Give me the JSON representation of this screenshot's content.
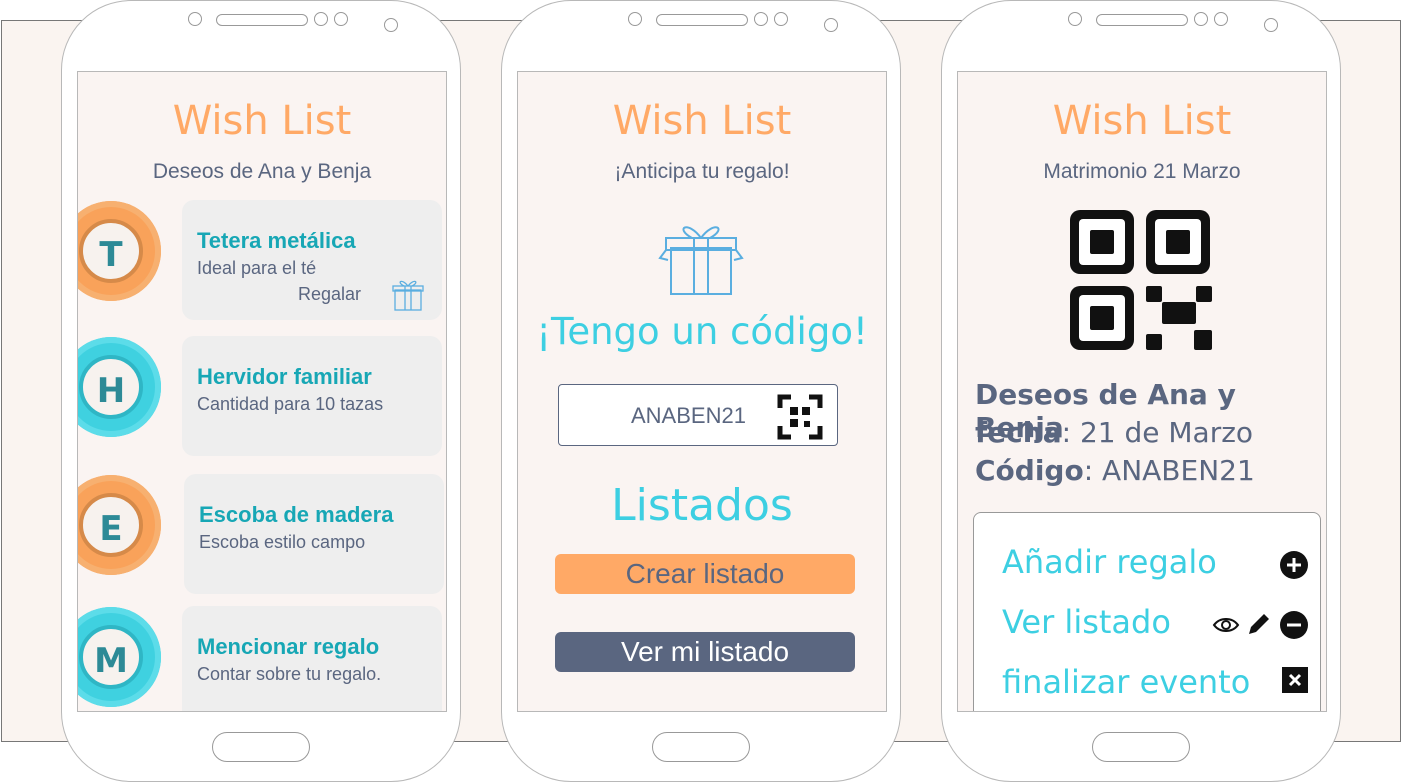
{
  "screens": [
    {
      "title": "Wish List",
      "subtitle": "Deseos de Ana y Benja",
      "items": [
        {
          "letter": "T",
          "name": "Tetera metálica",
          "desc": "Ideal para el té",
          "action": "Regalar",
          "color": "#f9a25a"
        },
        {
          "letter": "H",
          "name": "Hervidor familiar",
          "desc": "Cantidad para 10 tazas",
          "color": "#3fd1e0"
        },
        {
          "letter": "E",
          "name": "Escoba de madera",
          "desc": "Escoba estilo campo",
          "color": "#f9a25a"
        },
        {
          "letter": "M",
          "name": "Mencionar regalo",
          "desc": "Contar sobre tu regalo.",
          "color": "#3fd1e0"
        }
      ]
    },
    {
      "title": "Wish List",
      "subtitle": "¡Anticipa tu regalo!",
      "code_title": "¡Tengo un código!",
      "code_value": "ANABEN21",
      "list_title": "Listados",
      "create_button": "Crear listado",
      "view_button": "Ver mi listado"
    },
    {
      "title": "Wish List",
      "subtitle": "Matrimonio 21 Marzo",
      "info_heading": "Deseos de Ana y Benja",
      "date_label": "fecha",
      "date_value": ": 21  de Marzo",
      "code_label": "Código",
      "code_value": ": ANABEN21",
      "actions": {
        "add": "Añadir regalo",
        "view": "Ver listado",
        "finish": "finalizar evento"
      }
    }
  ],
  "icons": [
    "gift-icon",
    "qr-code-icon",
    "plus-circle-icon",
    "eye-icon",
    "pencil-icon",
    "minus-circle-icon",
    "close-box-icon"
  ],
  "colors": {
    "accent_orange": "#ffa966",
    "accent_cyan": "#3dcfe2",
    "text_dark": "#5a6680",
    "item_title": "#17a7b5"
  }
}
